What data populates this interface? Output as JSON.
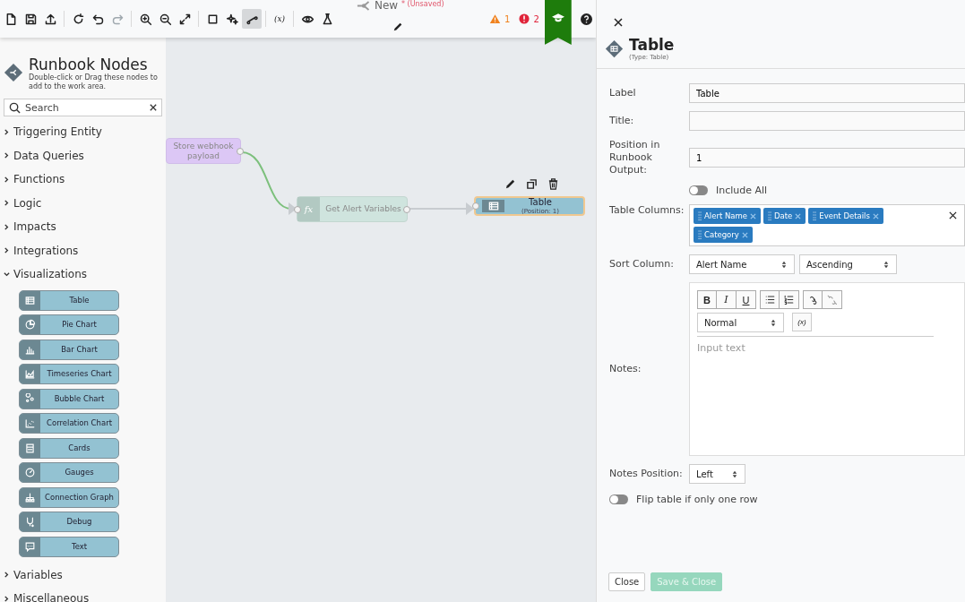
{
  "toolbar": {
    "tools": [
      {
        "kind": "new",
        "selected": false,
        "disabled": false
      },
      {
        "kind": "save",
        "selected": false,
        "disabled": false
      },
      {
        "kind": "export",
        "selected": false,
        "disabled": false
      },
      {
        "kind": "reset",
        "selected": false,
        "disabled": false
      },
      {
        "kind": "undo",
        "selected": false,
        "disabled": false
      },
      {
        "kind": "redo",
        "selected": false,
        "disabled": true
      },
      {
        "kind": "zoom-in",
        "selected": false,
        "disabled": false
      },
      {
        "kind": "zoom-out",
        "selected": false,
        "disabled": false
      },
      {
        "kind": "fit",
        "selected": false,
        "disabled": false
      },
      {
        "kind": "select",
        "selected": false,
        "disabled": false
      },
      {
        "kind": "sparkle",
        "selected": false,
        "disabled": false
      },
      {
        "kind": "connect",
        "selected": true,
        "disabled": false
      },
      {
        "kind": "variables",
        "label": "(x)",
        "selected": false,
        "disabled": false
      },
      {
        "kind": "preview",
        "selected": false,
        "disabled": false
      },
      {
        "kind": "test",
        "selected": false,
        "disabled": false
      }
    ],
    "runbook_name": "New",
    "unsaved_mark": "*",
    "unsaved_label": "(Unsaved)",
    "warnings": "1",
    "errors": "2"
  },
  "sidebar": {
    "title": "Runbook Nodes",
    "subtitle": "Double-click or Drag these nodes to add to the work area.",
    "search": {
      "placeholder": "Search"
    },
    "categories": [
      {
        "label": "Triggering Entity",
        "expanded": false
      },
      {
        "label": "Data Queries",
        "expanded": false
      },
      {
        "label": "Functions",
        "expanded": false
      },
      {
        "label": "Logic",
        "expanded": false
      },
      {
        "label": "Impacts",
        "expanded": false
      },
      {
        "label": "Integrations",
        "expanded": false
      },
      {
        "label": "Visualizations",
        "expanded": true,
        "children": [
          {
            "label": "Table",
            "kind": "table"
          },
          {
            "label": "Pie Chart",
            "kind": "pie"
          },
          {
            "label": "Bar Chart",
            "kind": "bar"
          },
          {
            "label": "Timeseries Chart",
            "kind": "timeseries"
          },
          {
            "label": "Bubble Chart",
            "kind": "bubble"
          },
          {
            "label": "Correlation Chart",
            "kind": "correlation"
          },
          {
            "label": "Cards",
            "kind": "cards"
          },
          {
            "label": "Gauges",
            "kind": "gauges"
          },
          {
            "label": "Connection Graph",
            "kind": "graph"
          },
          {
            "label": "Debug",
            "kind": "debug"
          },
          {
            "label": "Text",
            "kind": "text"
          }
        ]
      },
      {
        "label": "Variables",
        "expanded": false
      },
      {
        "label": "Miscellaneous",
        "expanded": false
      }
    ]
  },
  "canvas": {
    "nodes": [
      {
        "kind": "store",
        "label": "Store webhook payload",
        "selected": false
      },
      {
        "kind": "function",
        "icon_text": "fx",
        "label": "Get Alert Variables",
        "selected": false
      },
      {
        "kind": "table",
        "label": "Table",
        "sublabel": "(Position: 1)",
        "selected": true
      }
    ]
  },
  "panel": {
    "title": "Table",
    "type": "(Type: Table)",
    "label_field": {
      "label": "Label",
      "value": "Table"
    },
    "title_field": {
      "label": "Title:"
    },
    "position_field": {
      "label": "Position in Runbook Output:",
      "value": "1"
    },
    "include_all": {
      "label": "Include All",
      "on": false
    },
    "table_columns": {
      "label": "Table Columns:",
      "tags": [
        "Alert Name",
        "Date",
        "Event Details",
        "Category"
      ]
    },
    "sort": {
      "label": "Sort Column:",
      "column": "Alert Name",
      "order": "Ascending"
    },
    "notes": {
      "label": "Notes:",
      "placeholder": "Input text",
      "format": "Normal",
      "tools": [
        {
          "kind": "bold",
          "label": "B"
        },
        {
          "kind": "italic",
          "label": "I"
        },
        {
          "kind": "underline",
          "label": "U"
        },
        {
          "kind": "bullets"
        },
        {
          "kind": "numbers"
        },
        {
          "kind": "link"
        },
        {
          "kind": "unlink"
        }
      ],
      "variable_label": "(x)"
    },
    "notes_position": {
      "label": "Notes Position:",
      "value": "Left"
    },
    "flip": {
      "label": "Flip table if only one row",
      "on": false
    },
    "buttons": [
      {
        "label": "Close",
        "kind": "secondary",
        "disabled": false
      },
      {
        "label": "Save & Close",
        "kind": "primary",
        "disabled": true
      }
    ]
  }
}
